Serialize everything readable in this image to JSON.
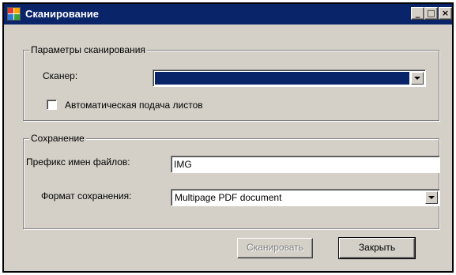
{
  "window": {
    "title": "Сканирование",
    "minimize_glyph": "_",
    "maximize_glyph": "□",
    "close_glyph": "×"
  },
  "scan_params": {
    "legend": "Параметры сканирования",
    "scanner_label": "Сканер:",
    "scanner_value": "",
    "auto_feed_label": "Автоматическая подача листов",
    "auto_feed_checked": false
  },
  "save": {
    "legend": "Сохранение",
    "prefix_label": "Префикс имен файлов:",
    "prefix_value": "IMG",
    "format_label": "Формат сохранения:",
    "format_value": "Multipage PDF document"
  },
  "buttons": {
    "scan_label": "Сканировать",
    "close_label": "Закрыть"
  },
  "colors": {
    "titlebar": "#0a246a",
    "face": "#d4d0c8",
    "selection": "#0a246a"
  }
}
